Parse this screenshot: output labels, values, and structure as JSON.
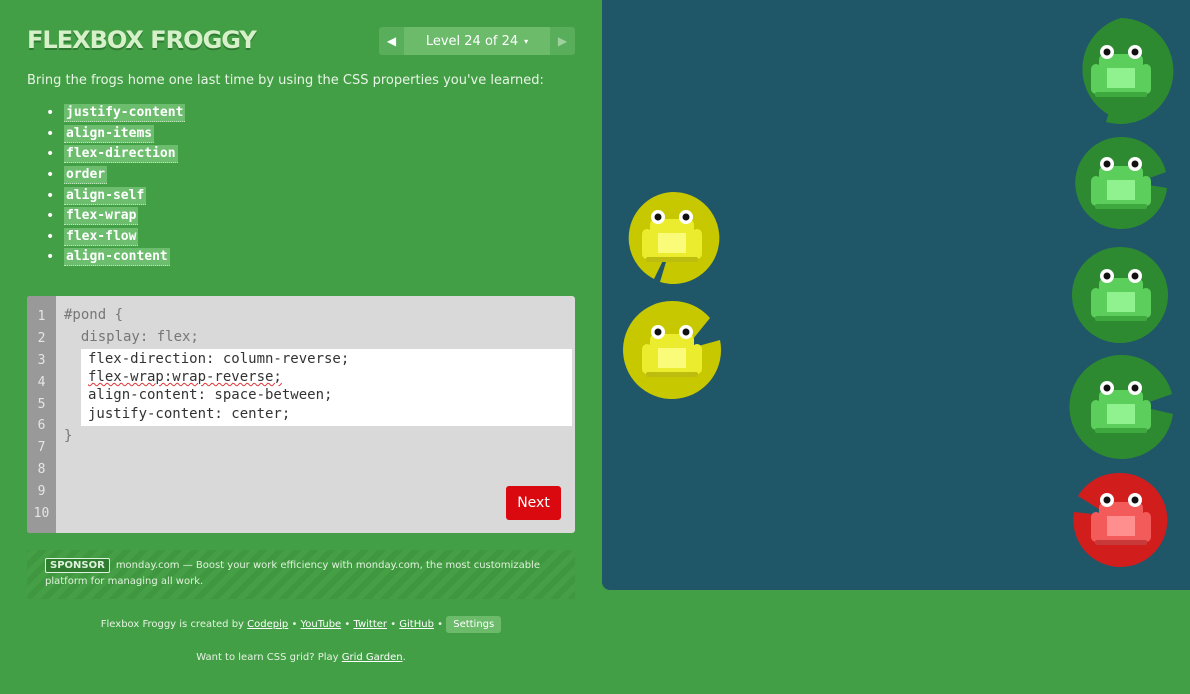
{
  "app": {
    "title": "FLEXBOX FROGGY"
  },
  "level_nav": {
    "prev_icon": "◀",
    "next_icon": "▶",
    "level_text": "Level 24 of 24",
    "caret": "▾"
  },
  "instructions": "Bring the frogs home one last time by using the CSS properties you've learned:",
  "properties": [
    "justify-content",
    "align-items",
    "flex-direction",
    "order",
    "align-self",
    "flex-wrap",
    "flex-flow",
    "align-content"
  ],
  "editor": {
    "line_numbers": [
      "1",
      "2",
      "3",
      "4",
      "5",
      "6",
      "7",
      "8",
      "9",
      "10"
    ],
    "line1": "#pond {",
    "line2": "  display: flex;",
    "input_lines": [
      "flex-direction: column-reverse;",
      "flex-wrap:wrap-reverse;",
      "align-content: space-between;",
      "justify-content: center;"
    ],
    "closing": "}",
    "next_label": "Next"
  },
  "sponsor": {
    "badge": "SPONSOR",
    "text": "monday.com — Boost your work efficiency with monday.com, the most customizable platform for managing all work."
  },
  "footer": {
    "created_by": "Flexbox Froggy is created by",
    "links": [
      "Codepip",
      "YouTube",
      "Twitter",
      "GitHub"
    ],
    "separator": "•",
    "settings_label": "Settings",
    "grid_text": "Want to learn CSS grid? Play",
    "grid_link": "Grid Garden",
    "grid_end": "."
  },
  "colors": {
    "background": "#439f45",
    "pond": "#1f5768",
    "next_button": "#d9090f",
    "green_pad": "#2e8a30",
    "yellow_pad": "#c8c800",
    "red_pad": "#d21d1d"
  }
}
